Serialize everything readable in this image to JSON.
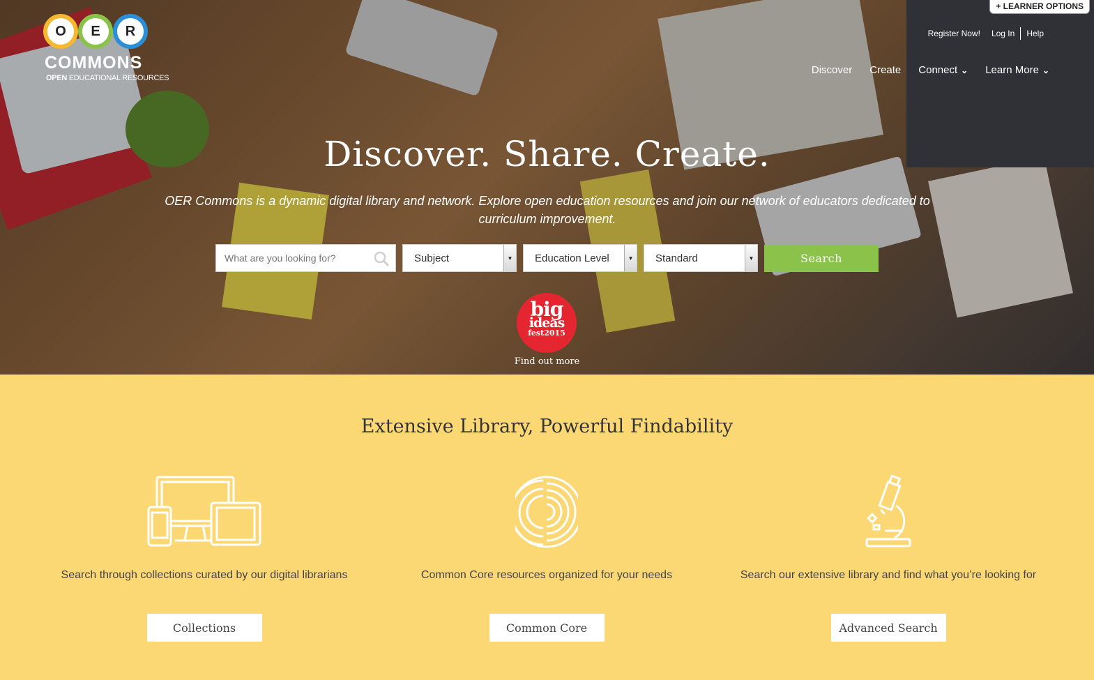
{
  "header": {
    "learner_options": "+ LEARNER OPTIONS",
    "logo": {
      "letters": [
        "O",
        "E",
        "R"
      ],
      "commons": "COMMONS",
      "sub_bold": "OPEN",
      "sub_rest": " EDUCATIONAL RESOURCES",
      "ring_colors": [
        "#f5b82e",
        "#8bc34a",
        "#2b8fd6"
      ]
    },
    "util_nav": {
      "register": "Register Now!",
      "login": "Log In",
      "help": "Help"
    },
    "main_nav": [
      {
        "label": "Discover",
        "has_dropdown": false
      },
      {
        "label": "Create",
        "has_dropdown": false
      },
      {
        "label": "Connect",
        "has_dropdown": true
      },
      {
        "label": "Learn More",
        "has_dropdown": true
      }
    ]
  },
  "hero": {
    "title": "Discover. Share. Create.",
    "description": "OER Commons is a dynamic digital library and network. Explore open education resources and join our network of educators dedicated to curriculum improvement.",
    "search": {
      "placeholder": "What are you looking for?",
      "subject": "Subject",
      "education_level": "Education Level",
      "standard": "Standard",
      "button": "Search"
    },
    "badge": {
      "line1": "big",
      "line2": "ideas",
      "line3": "fest2015"
    },
    "find_more": "Find out more"
  },
  "library": {
    "title": "Extensive Library, Powerful Findability",
    "features": [
      {
        "icon": "devices-icon",
        "description": "Search through collections curated by our digital librarians",
        "button": "Collections"
      },
      {
        "icon": "common-core-icon",
        "description": "Common Core resources organized for your needs",
        "button": "Common Core"
      },
      {
        "icon": "microscope-icon",
        "description": "Search our extensive library and find what you’re looking for",
        "button": "Advanced Search"
      }
    ]
  },
  "colors": {
    "accent_green": "#8bc34a",
    "section_yellow": "#fcd874",
    "badge_red": "#e32630"
  }
}
